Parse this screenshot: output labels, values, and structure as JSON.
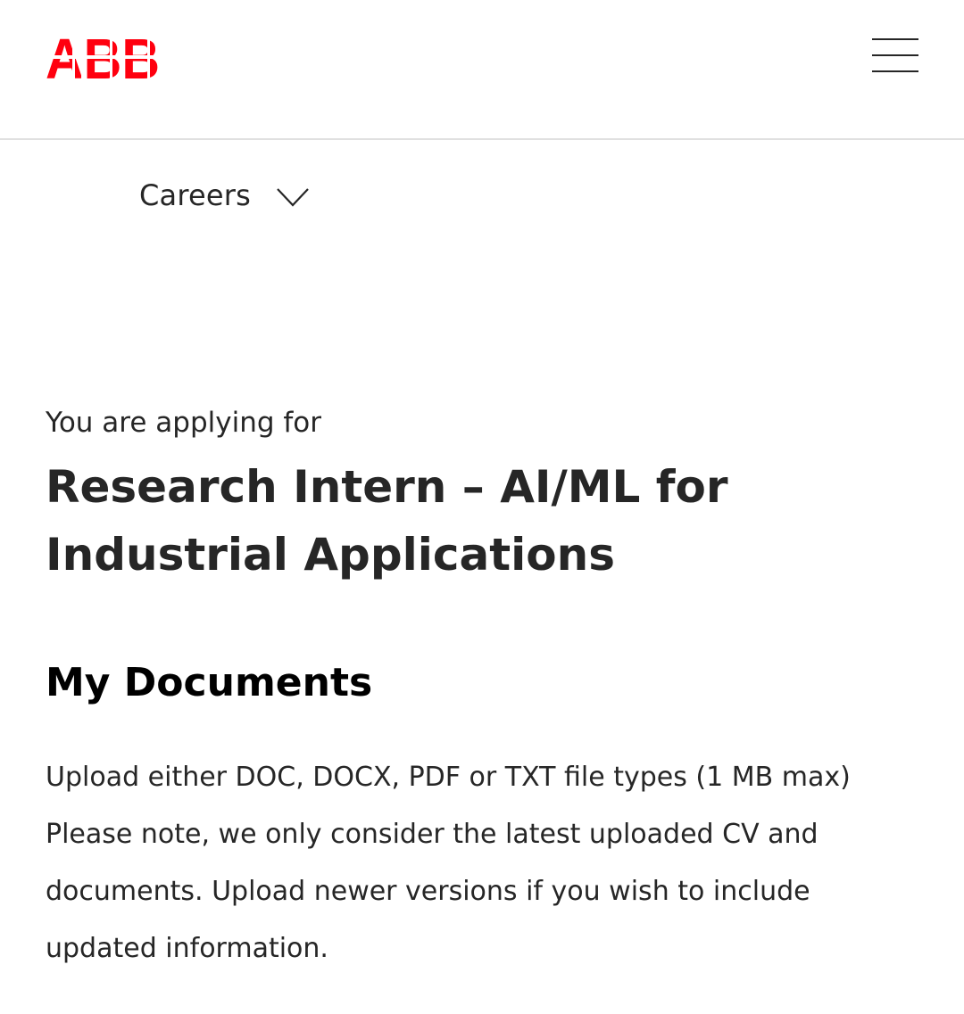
{
  "header": {
    "logo_text": "ABB",
    "brand_color": "#ff000f",
    "menu_icon": "hamburger-menu-icon"
  },
  "nav": {
    "careers_label": "Careers",
    "dropdown_icon": "chevron-down-icon"
  },
  "application": {
    "applying_label": "You are applying for",
    "job_title": "Research Intern – AI/ML for Industrial Applications"
  },
  "documents": {
    "section_title": "My Documents",
    "file_types_note": "Upload either DOC, DOCX, PDF or TXT file types (1 MB max)",
    "latest_note": "Please note, we only consider the latest uploaded CV and documents. Upload newer versions if you wish to include updated information."
  }
}
